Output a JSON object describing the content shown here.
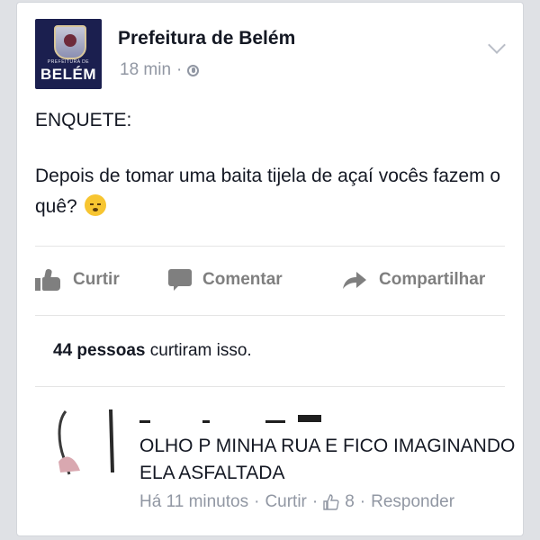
{
  "post": {
    "page_name": "Prefeitura de Belém",
    "logo": {
      "brand_text": "BELÉM",
      "small_text": "PREFEITURA DE",
      "icon": "city-crest-logo"
    },
    "time": "18 min",
    "meta_separator": "·",
    "privacy_icon": "globe-icon",
    "menu_icon": "chevron-down-icon",
    "poll_title": "ENQUETE:",
    "body": "Depois de tomar uma baita tijela de açaí vocês fazem o quê?",
    "emoji": "sleepy-face-emoji"
  },
  "actions": [
    {
      "label": "Curtir",
      "icon": "thumbs-up-icon"
    },
    {
      "label": "Comentar",
      "icon": "speech-bubble-icon"
    },
    {
      "label": "Compartilhar",
      "icon": "share-arrow-icon"
    }
  ],
  "likes_summary": {
    "count_text": "44 pessoas",
    "suffix": " curtiram isso."
  },
  "comment": {
    "author": "",
    "text": "OLHO P MINHA RUA E FICO IMAGINANDO ELA ASFALTADA",
    "time": "Há 11 minutos",
    "separator": "·",
    "like_label": "Curtir",
    "like_count": "8",
    "reply_label": "Responder",
    "like_icon": "thumbs-up-outline-icon"
  },
  "colors": {
    "card_background": "#ffffff",
    "page_background": "#dfe1e5",
    "text_primary": "#141823",
    "text_secondary": "#9197a3",
    "action_gray": "#7f7f7f",
    "logo_navy": "#1b1f4f"
  }
}
